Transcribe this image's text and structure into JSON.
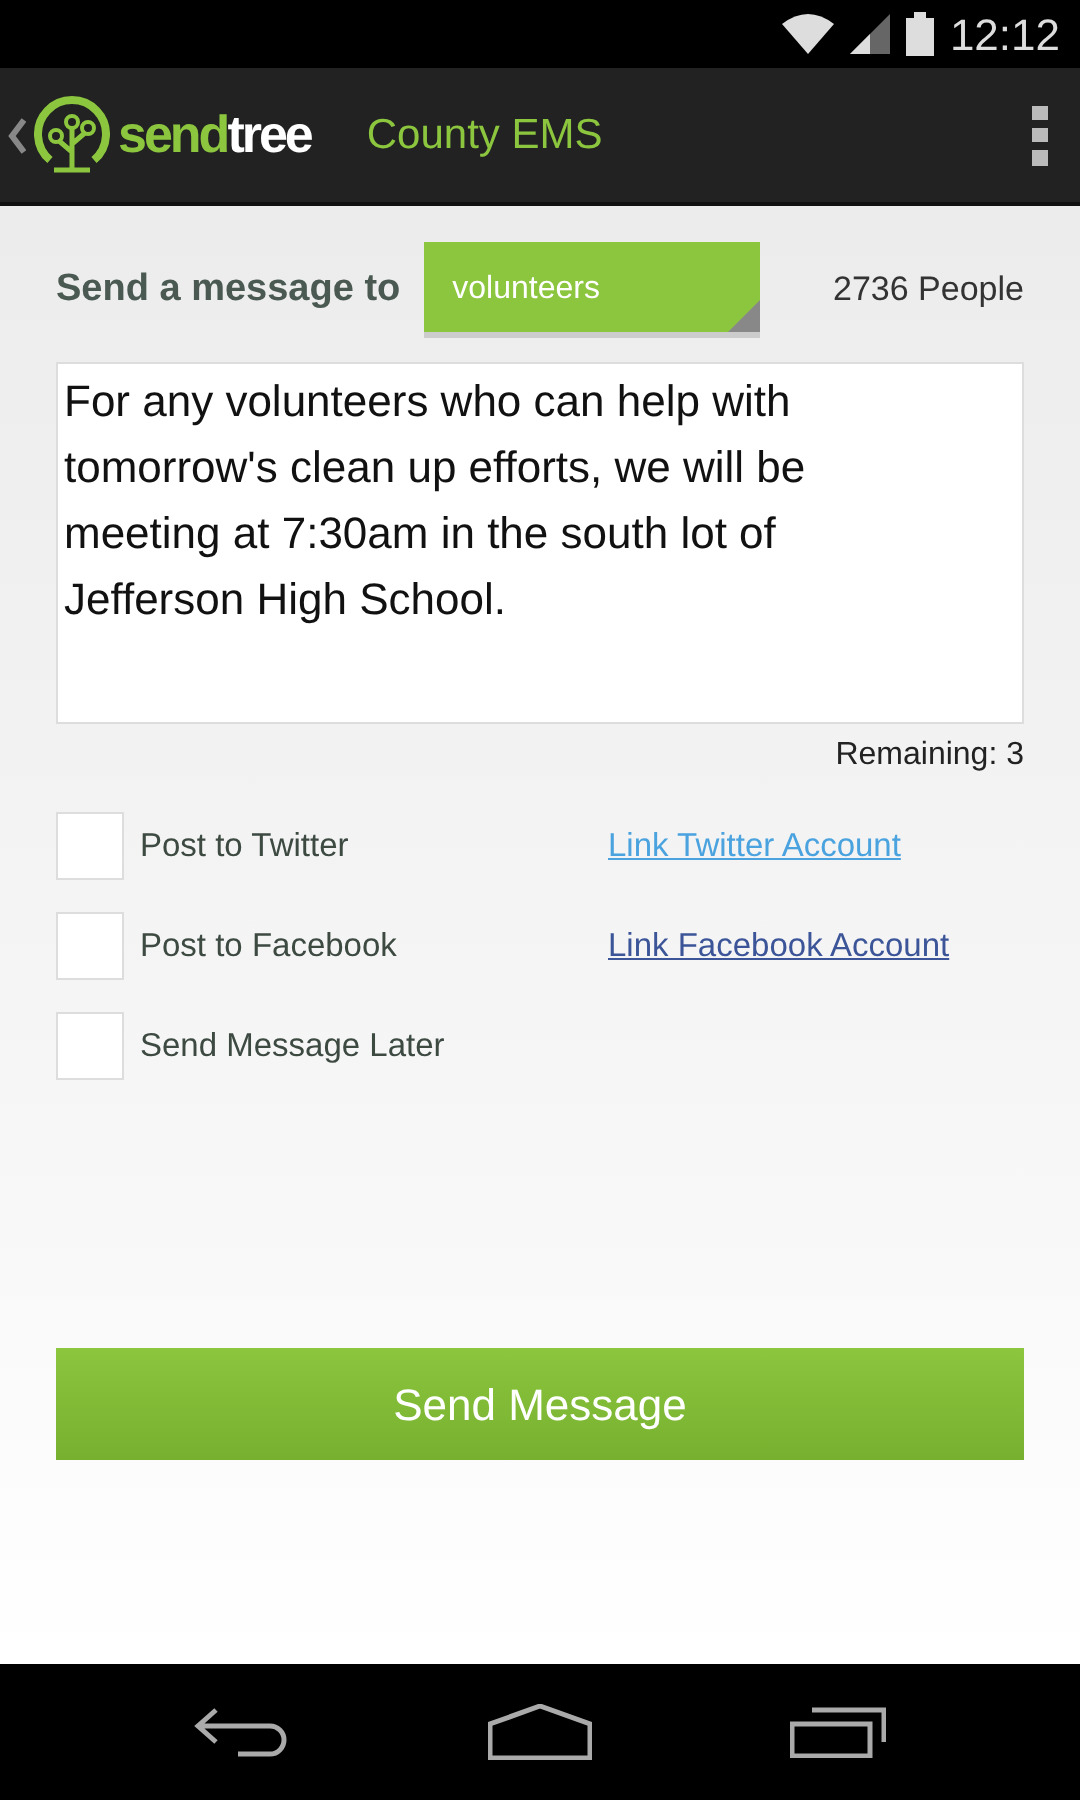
{
  "status_bar": {
    "time": "12:12"
  },
  "action_bar": {
    "logo_parts": [
      {
        "text": "send",
        "kind": "accent"
      },
      {
        "text": "tree",
        "kind": "plain"
      }
    ],
    "title": "County EMS"
  },
  "recipient": {
    "label": "Send a message to",
    "group": "volunteers",
    "count": "2736 People"
  },
  "message": {
    "value": "For any volunteers who can help with tomorrow's clean up efforts, we will be meeting at 7:30am in the south lot of Jefferson High School.",
    "remaining": "Remaining: 3"
  },
  "options": [
    {
      "label": "Post to Twitter",
      "checked": false,
      "link": "Link Twitter Account",
      "color": "#4aa3df"
    },
    {
      "label": "Post to Facebook",
      "checked": false,
      "link": "Link Facebook Account",
      "color": "#3b5598"
    },
    {
      "label": "Send Message Later",
      "checked": false
    }
  ],
  "send_button": "Send Message"
}
